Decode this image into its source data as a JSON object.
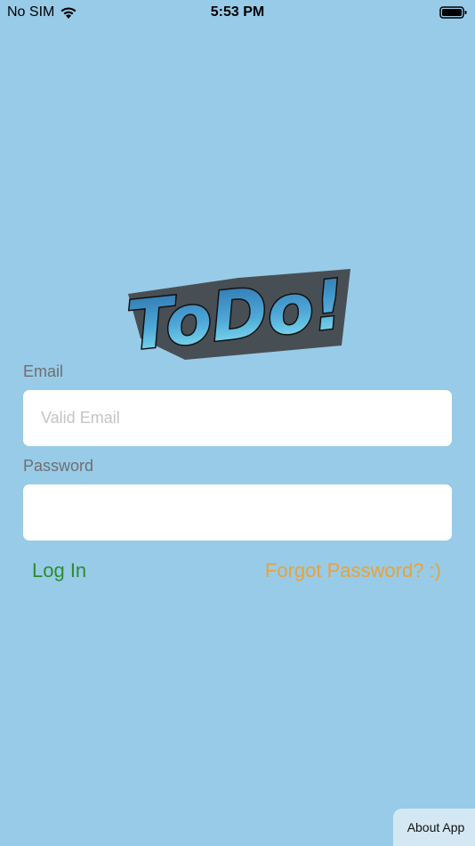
{
  "status_bar": {
    "carrier": "No SIM",
    "time": "5:53 PM"
  },
  "logo": {
    "text": "ToDo!"
  },
  "form": {
    "email_label": "Email",
    "email_placeholder": "Valid Email",
    "email_value": "",
    "password_label": "Password",
    "password_placeholder": "",
    "password_value": ""
  },
  "actions": {
    "login_label": "Log In",
    "forgot_label": "Forgot Password? :)",
    "about_label": "About App"
  },
  "colors": {
    "background": "#98CBE8",
    "login": "#2E8B2E",
    "forgot": "#E8A23A",
    "logo_fill": "#3E8FC7"
  }
}
